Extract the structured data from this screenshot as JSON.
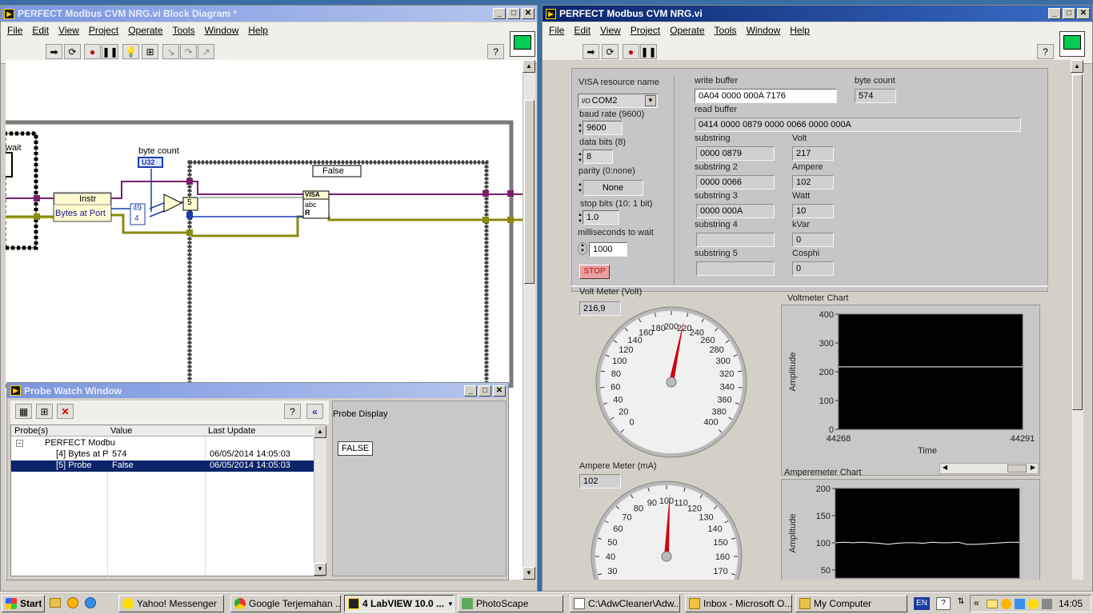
{
  "block_diagram": {
    "title": "PERFECT Modbus CVM NRG.vi Block Diagram *",
    "menu": [
      "File",
      "Edit",
      "View",
      "Project",
      "Operate",
      "Tools",
      "Window",
      "Help"
    ],
    "labels": {
      "wait": "wait",
      "byte_count": "byte count",
      "u32": "U32",
      "instr": "Instr",
      "bytes_at_port": "Bytes at Port",
      "const_49": "49",
      "const_4": "4",
      "const_5": "5",
      "case_selector": "False",
      "visa": "VISA",
      "abc": "abc",
      "r": "R"
    }
  },
  "probe_window": {
    "title": "Probe Watch Window",
    "columns": [
      "Probe(s)",
      "Value",
      "Last Update"
    ],
    "rows": [
      {
        "probe": "PERFECT Modbu",
        "value": "",
        "last_update": ""
      },
      {
        "probe": "[4] Bytes at P",
        "value": "574",
        "last_update": "06/05/2014 14:05:03"
      },
      {
        "probe": "[5] Probe",
        "value": "False",
        "last_update": "06/05/2014 14:05:03"
      }
    ],
    "display_label": "Probe Display",
    "display_value": "FALSE"
  },
  "front_panel": {
    "title": "PERFECT Modbus CVM NRG.vi",
    "menu": [
      "File",
      "Edit",
      "View",
      "Project",
      "Operate",
      "Tools",
      "Window",
      "Help"
    ],
    "visa_resource_label": "VISA resource name",
    "visa_resource_value": "COM2",
    "baud_rate_label": "baud rate (9600)",
    "baud_rate_value": "9600",
    "data_bits_label": "data bits (8)",
    "data_bits_value": "8",
    "parity_label": "parity (0:none)",
    "parity_value": "None",
    "stop_bits_label": "stop bits (10: 1 bit)",
    "stop_bits_value": "1.0",
    "ms_wait_label": "milliseconds to wait",
    "ms_wait_value": "1000",
    "stop_label": "STOP",
    "write_buffer_label": "write buffer",
    "write_buffer_value": "0A04 0000 000A 7176",
    "byte_count_label": "byte count",
    "byte_count_value": "574",
    "read_buffer_label": "read buffer",
    "read_buffer_value": "0414 0000 0879 0000 0066 0000 000A",
    "substrings": [
      {
        "label": "substring",
        "value": "0000 0879"
      },
      {
        "label": "substring 2",
        "value": "0000 0066"
      },
      {
        "label": "substring 3",
        "value": "0000 000A"
      },
      {
        "label": "substring 4",
        "value": ""
      },
      {
        "label": "substring 5",
        "value": ""
      }
    ],
    "measures": [
      {
        "label": "Volt",
        "value": "217"
      },
      {
        "label": "Ampere",
        "value": "102"
      },
      {
        "label": "Watt",
        "value": "10"
      },
      {
        "label": "kVar",
        "value": "0"
      },
      {
        "label": "Cosphi",
        "value": "0"
      }
    ],
    "volt_meter": {
      "label": "Volt Meter (Volt)",
      "digital": "216,9",
      "value": 216.9,
      "ticks": [
        "0",
        "20",
        "40",
        "60",
        "80",
        "100",
        "120",
        "140",
        "160",
        "180",
        "200",
        "220",
        "240",
        "260",
        "280",
        "300",
        "320",
        "340",
        "360",
        "380",
        "400"
      ]
    },
    "ampere_meter": {
      "label": "Ampere Meter (mA)",
      "digital": "102",
      "value": 102,
      "ticks": [
        "30",
        "40",
        "50",
        "60",
        "70",
        "80",
        "90",
        "100",
        "110",
        "120",
        "130",
        "140",
        "150",
        "160",
        "170"
      ]
    },
    "voltmeter_chart": {
      "title": "Voltmeter Chart",
      "ylabel": "Amplitude",
      "xlabel": "Time",
      "yticks": [
        "400",
        "300",
        "200",
        "100",
        "0"
      ],
      "xticks": [
        "44268",
        "44291"
      ]
    },
    "amperemeter_chart": {
      "title": "Amperemeter Chart",
      "ylabel": "Amplitude",
      "yticks": [
        "200",
        "150",
        "100",
        "50"
      ]
    }
  },
  "chart_data": [
    {
      "type": "line",
      "title": "Voltmeter Chart",
      "xlabel": "Time",
      "ylabel": "Amplitude",
      "xlim": [
        44268,
        44291
      ],
      "ylim": [
        0,
        400
      ],
      "series": [
        {
          "values": [
            217,
            217,
            217,
            217,
            217,
            217,
            217,
            217,
            217,
            217,
            217,
            217,
            217,
            217,
            217,
            217,
            217,
            217,
            217,
            217,
            217,
            217,
            217,
            217
          ]
        }
      ]
    },
    {
      "type": "line",
      "title": "Amperemeter Chart",
      "xlabel": "",
      "ylabel": "Amplitude",
      "ylim": [
        35,
        200
      ],
      "series": [
        {
          "values": [
            100,
            101,
            100,
            101,
            100,
            99,
            97,
            99,
            100,
            100,
            99,
            101,
            100,
            100,
            101,
            97,
            97,
            98,
            99,
            100,
            101,
            101
          ]
        }
      ]
    }
  ],
  "taskbar": {
    "start": "Start",
    "tasks": [
      "Yahoo! Messenger",
      "Google Terjemahan ...",
      "4 LabVIEW 10.0 ...",
      "PhotoScape",
      "C:\\AdwCleaner\\Adw...",
      "Inbox - Microsoft O...",
      "My Computer"
    ],
    "lang": "EN",
    "clock": "14:05"
  }
}
